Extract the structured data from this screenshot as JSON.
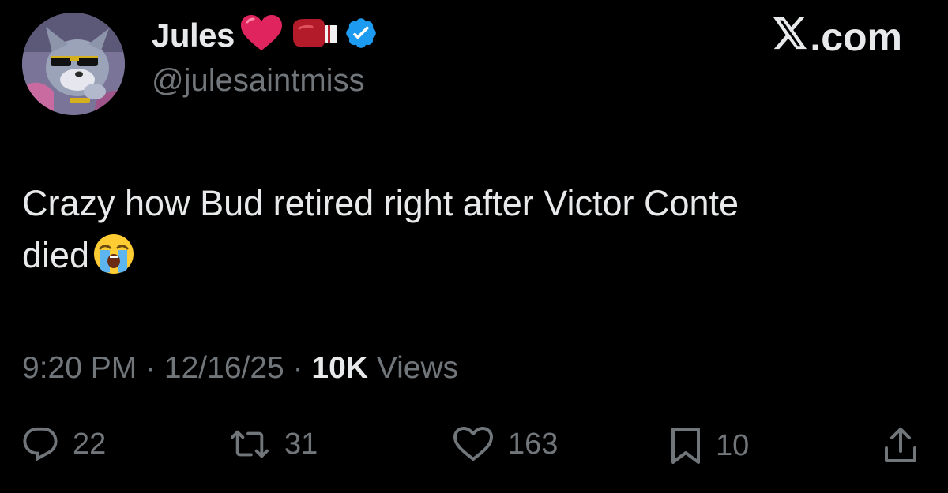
{
  "author": {
    "display_name": "Jules",
    "name_emojis": [
      "heart-emoji",
      "boxing-glove-emoji"
    ],
    "verified": true,
    "handle": "@julesaintmiss",
    "avatar": "cartoon-cat-avatar"
  },
  "brand": {
    "logo_text": ".com",
    "logo_icon": "x-logo-icon"
  },
  "tweet": {
    "text_line1": "Crazy how Bud retired right after Victor Conte",
    "text_line2": "died",
    "text_emoji": "loudly-crying-face-emoji"
  },
  "meta": {
    "time": "9:20 PM",
    "sep1": " · ",
    "date": "12/16/25",
    "sep2": " · ",
    "views_count": "10K",
    "views_label": " Views"
  },
  "actions": {
    "replies": "22",
    "reposts": "31",
    "likes": "163",
    "bookmarks": "10"
  },
  "colors": {
    "background": "#000000",
    "text_primary": "#e7e9ea",
    "text_secondary": "#71767b",
    "verified_badge": "#1d9bf0",
    "heart": "#e0245e"
  }
}
